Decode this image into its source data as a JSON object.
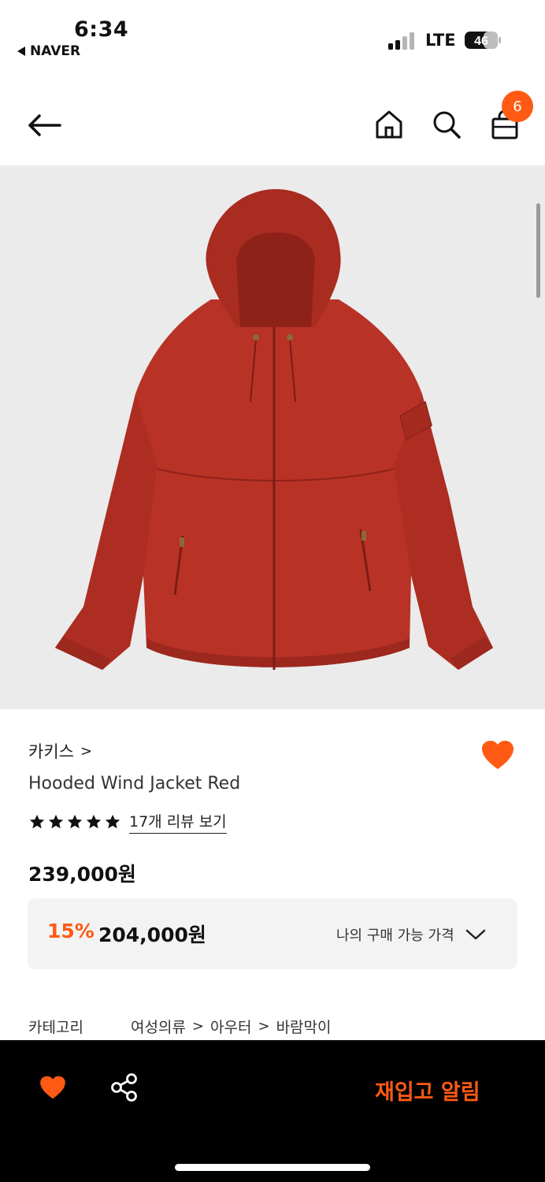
{
  "status_bar": {
    "time": "6:34",
    "back_app": "NAVER",
    "network": "LTE",
    "battery": "46"
  },
  "header": {
    "cart_count": "6"
  },
  "product": {
    "brand": "카키스",
    "brand_chevron": ">",
    "name": "Hooded Wind Jacket Red",
    "rating_stars": 5,
    "review_link": "17개 리뷰 보기",
    "price": "239,000원",
    "discount_percent": "15%",
    "sale_price": "204,000원",
    "my_price_label": "나의 구매 가능 가격",
    "image_color": "#b83226"
  },
  "category": {
    "label": "카테고리",
    "path": [
      "여성의류",
      "아우터",
      "바람막이"
    ],
    "separator": ">"
  },
  "bottom_bar": {
    "restock_label": "재입고 알림"
  },
  "colors": {
    "accent": "#ff5a14"
  }
}
